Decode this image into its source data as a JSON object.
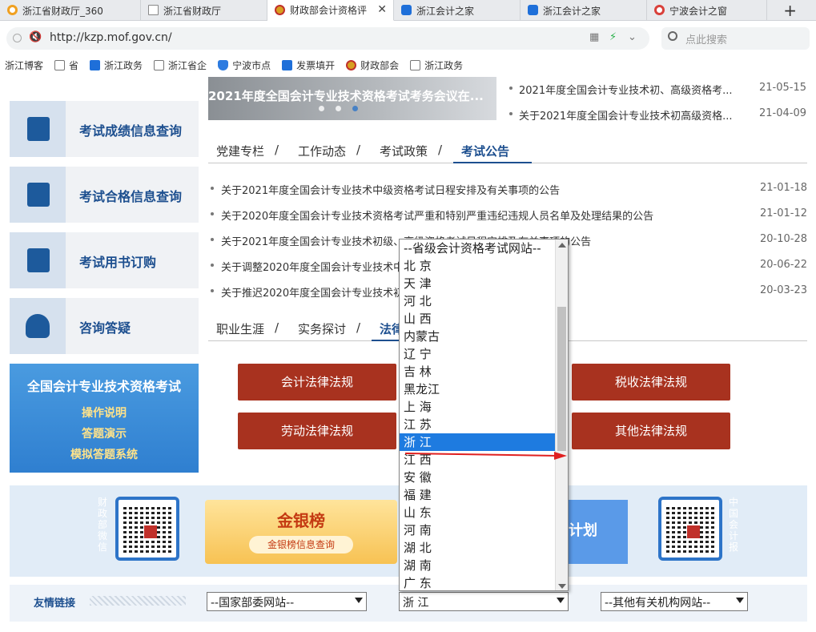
{
  "browser": {
    "tabs": [
      {
        "label": "浙江省财政厅_360",
        "icon": "ring"
      },
      {
        "label": "浙江省财政厅",
        "icon": "doc"
      },
      {
        "label": "财政部会计资格评",
        "icon": "emb",
        "active": true
      },
      {
        "label": "浙江会计之家",
        "icon": "blue"
      },
      {
        "label": "浙江会计之家",
        "icon": "blue"
      },
      {
        "label": "宁波会计之窗",
        "icon": "red"
      }
    ],
    "new_tab": "+",
    "close": "✕",
    "url": "http://kzp.mof.gov.cn/",
    "search_placeholder": "点此搜索",
    "bookmarks": [
      {
        "label": "浙江博客",
        "icon": "doc"
      },
      {
        "label": "省",
        "icon": "doc"
      },
      {
        "label": "浙江政务",
        "icon": "blue"
      },
      {
        "label": "浙江省企",
        "icon": "doc"
      },
      {
        "label": "宁波市点",
        "icon": "shield"
      },
      {
        "label": "发票填开",
        "icon": "blue"
      },
      {
        "label": "财政部会",
        "icon": "emb"
      },
      {
        "label": "浙江政务",
        "icon": "doc"
      }
    ]
  },
  "sidebar": {
    "items": [
      {
        "label": "考试成绩信息查询",
        "icon": "printer-icon"
      },
      {
        "label": "考试合格信息查询",
        "icon": "certificate-icon"
      },
      {
        "label": "考试用书订购",
        "icon": "book-icon"
      },
      {
        "label": "咨询答疑",
        "icon": "person-icon"
      }
    ],
    "promo": {
      "title": "全国会计专业技术资格考试",
      "lines": [
        "操作说明",
        "答题演示",
        "模拟答题系统"
      ]
    }
  },
  "banner": {
    "caption": "2021年度全国会计专业技术资格考试考务会议在..."
  },
  "top_news": [
    {
      "title": "2021年度全国会计专业技术初、高级资格考...",
      "date": "21-05-15"
    },
    {
      "title": "关于2021年度全国会计专业技术初高级资格...",
      "date": "21-04-09"
    }
  ],
  "tabs1": {
    "items": [
      "党建专栏",
      "工作动态",
      "考试政策",
      "考试公告"
    ],
    "sep": "/"
  },
  "notices": [
    {
      "title": "关于2021年度全国会计专业技术中级资格考试日程安排及有关事项的公告",
      "date": "21-01-18"
    },
    {
      "title": "关于2020年度全国会计专业技术资格考试严重和特别严重违纪违规人员名单及处理结果的公告",
      "date": "21-01-12"
    },
    {
      "title": "关于2021年度全国会计专业技术初级、高级资格考试日程安排及有关事项的公告",
      "date": "20-10-28"
    },
    {
      "title": "关于调整2020年度全国会计专业技术中级资格考试有关事项的公告",
      "date": "20-06-22"
    },
    {
      "title": "关于推迟2020年度全国会计专业技术初级资格考试有关事项的公告",
      "date": "20-03-23"
    }
  ],
  "tabs2": {
    "items": [
      "职业生涯",
      "实务探讨",
      "法律"
    ],
    "sep": "/"
  },
  "law_buttons": [
    "会计法律法规",
    "税收法律法规",
    "劳动法律法规",
    "其他法律法规"
  ],
  "qr_section": {
    "left_vertical": "财政部微信",
    "right_vertical": "中国会计报",
    "gold_title": "金银榜",
    "gold_sub": "金银榜信息查询",
    "plan_label": "计划"
  },
  "links": {
    "label": "友情链接",
    "select1": "--国家部委网站--",
    "select2": "浙 江",
    "select3": "--其他有关机构网站--"
  },
  "dropdown": {
    "options": [
      "--省级会计资格考试网站--",
      "北 京",
      "天 津",
      "河 北",
      "山 西",
      "内蒙古",
      "辽 宁",
      "吉 林",
      "黑龙江",
      "上 海",
      "江 苏",
      "浙 江",
      "江 西",
      "安 徽",
      "福 建",
      "山 东",
      "河 南",
      "湖 北",
      "湖 南",
      "广 东"
    ],
    "selected_index": 11
  },
  "colors": {
    "accent": "#1d4f8f",
    "law_red": "#a8321f",
    "select_blue": "#1e7be0",
    "annot_red": "#e02020"
  }
}
